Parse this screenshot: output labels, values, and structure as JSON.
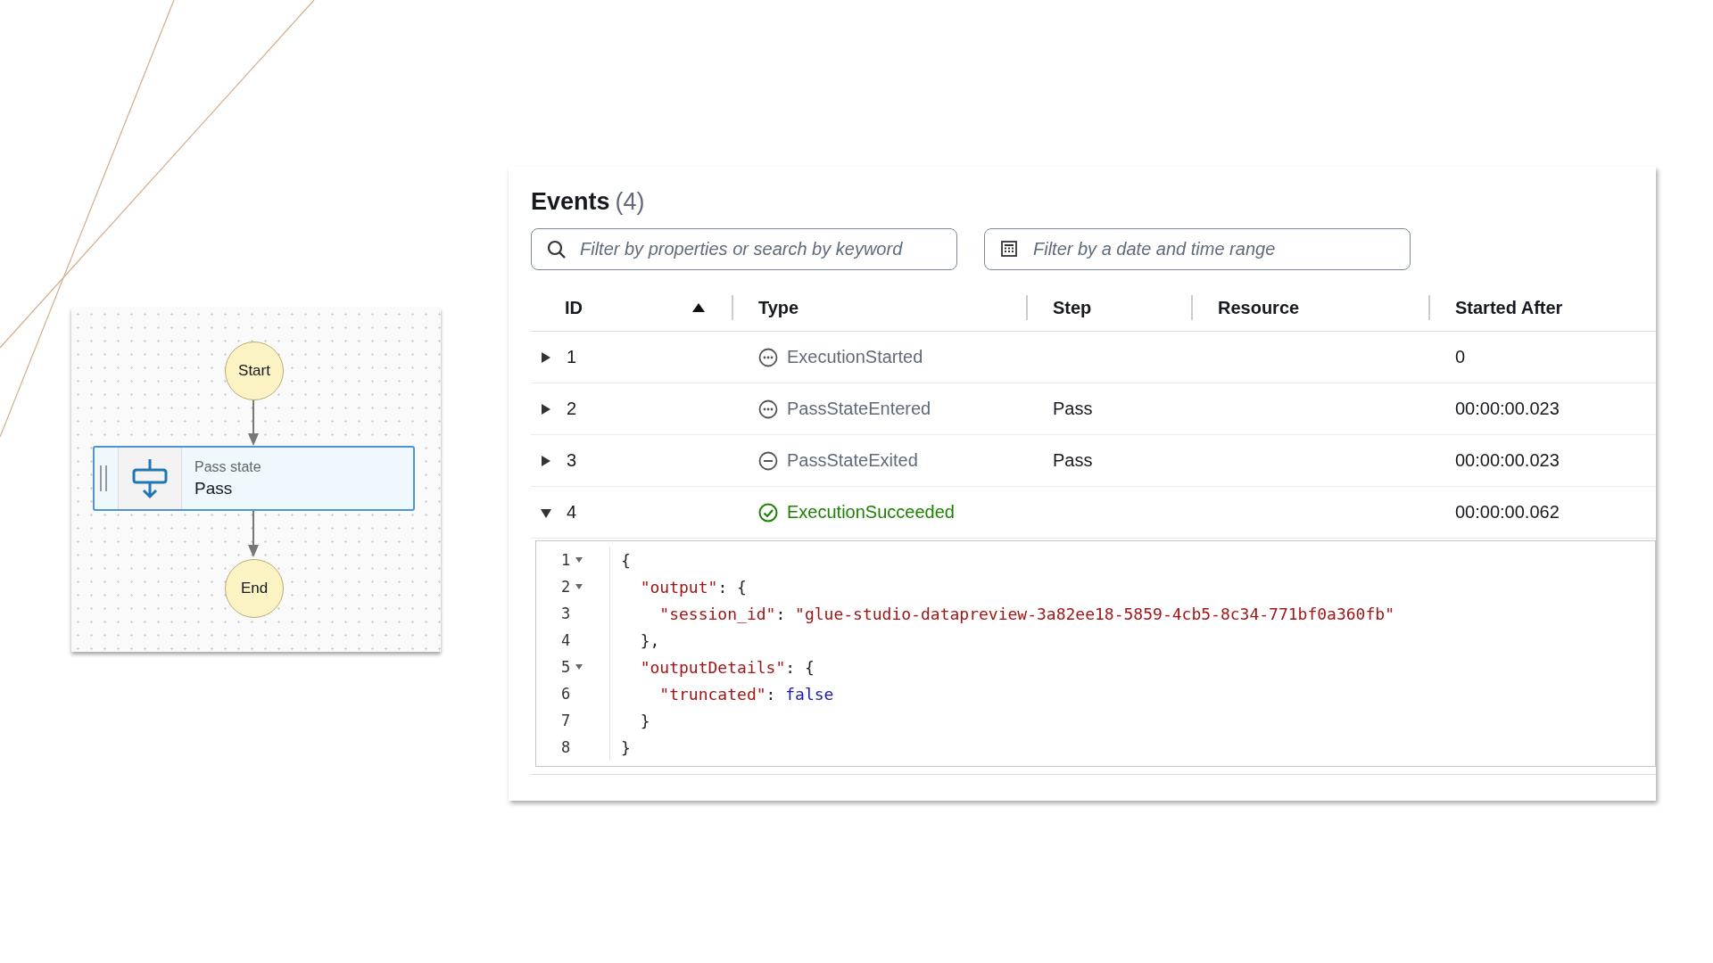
{
  "diagram": {
    "nodes": [
      {
        "kind": "terminal",
        "label": "Start"
      },
      {
        "kind": "state",
        "type_label": "Pass state",
        "label": "Pass"
      },
      {
        "kind": "terminal",
        "label": "End"
      }
    ]
  },
  "events": {
    "title": "Events",
    "count": "(4)",
    "search": {
      "placeholder": "Filter by properties or search by keyword"
    },
    "date_filter": {
      "placeholder": "Filter by a date and time range"
    },
    "columns": [
      {
        "label": "ID",
        "sorted": true
      },
      {
        "label": "Type",
        "sorted": false
      },
      {
        "label": "Step",
        "sorted": false
      },
      {
        "label": "Resource",
        "sorted": false
      },
      {
        "label": "Started After",
        "sorted": false
      }
    ],
    "rows": [
      {
        "id": "1",
        "expanded": false,
        "kind": "info",
        "type": "ExecutionStarted",
        "step": "",
        "resource": "",
        "started_after": "0"
      },
      {
        "id": "2",
        "expanded": false,
        "kind": "info",
        "type": "PassStateEntered",
        "step": "Pass",
        "resource": "",
        "started_after": "00:00:00.023"
      },
      {
        "id": "3",
        "expanded": false,
        "kind": "exited",
        "type": "PassStateExited",
        "step": "Pass",
        "resource": "",
        "started_after": "00:00:00.023"
      },
      {
        "id": "4",
        "expanded": true,
        "kind": "success",
        "type": "ExecutionSucceeded",
        "step": "",
        "resource": "",
        "started_after": "00:00:00.062"
      }
    ],
    "code": [
      {
        "number": "1",
        "foldable": true,
        "tokens": [
          {
            "kind": "punct",
            "text": "{"
          }
        ]
      },
      {
        "number": "2",
        "foldable": true,
        "tokens": [
          {
            "kind": "key",
            "text": "  \"output\""
          },
          {
            "kind": "punct",
            "text": ": {"
          }
        ]
      },
      {
        "number": "3",
        "foldable": false,
        "tokens": [
          {
            "kind": "key",
            "text": "    \"session_id\""
          },
          {
            "kind": "punct",
            "text": ": "
          },
          {
            "kind": "string",
            "text": "\"glue-studio-datapreview-3a82ee18-5859-4cb5-8c34-771bf0a360fb\""
          }
        ]
      },
      {
        "number": "4",
        "foldable": false,
        "tokens": [
          {
            "kind": "punct",
            "text": "  },"
          }
        ]
      },
      {
        "number": "5",
        "foldable": true,
        "tokens": [
          {
            "kind": "key",
            "text": "  \"outputDetails\""
          },
          {
            "kind": "punct",
            "text": ": {"
          }
        ]
      },
      {
        "number": "6",
        "foldable": false,
        "tokens": [
          {
            "kind": "key",
            "text": "    \"truncated\""
          },
          {
            "kind": "punct",
            "text": ": "
          },
          {
            "kind": "literal",
            "text": "false"
          }
        ]
      },
      {
        "number": "7",
        "foldable": false,
        "tokens": [
          {
            "kind": "punct",
            "text": "  }"
          }
        ]
      },
      {
        "number": "8",
        "foldable": false,
        "tokens": [
          {
            "kind": "punct",
            "text": "}"
          }
        ]
      }
    ]
  }
}
